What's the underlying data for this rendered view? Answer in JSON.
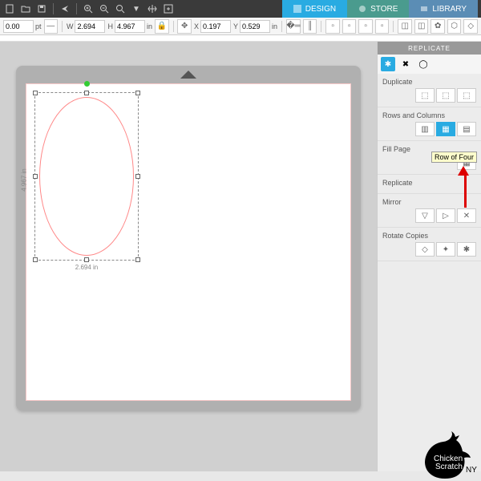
{
  "tabs": {
    "design": "DESIGN",
    "store": "STORE",
    "library": "LIBRARY"
  },
  "props": {
    "pt_val": "0.00",
    "pt_unit": "pt",
    "w_label": "W",
    "w_val": "2.694",
    "h_label": "H",
    "h_val": "4.967",
    "wh_unit": "in",
    "x_label": "X",
    "x_val": "0.197",
    "y_label": "Y",
    "y_val": "0.529",
    "xy_unit": "in"
  },
  "selection": {
    "width_label": "2.694 in",
    "height_label": "4.967 in"
  },
  "panel": {
    "title": "REPLICATE",
    "duplicate": "Duplicate",
    "rows_cols": "Rows and Columns",
    "fill_page": "Fill Page",
    "replicate": "Replicate",
    "mirror": "Mirror",
    "rotate": "Rotate Copies"
  },
  "tooltip": "Row of Four",
  "watermark": {
    "line1": "Chicken",
    "line2": "Scratch",
    "line3": "NY"
  }
}
